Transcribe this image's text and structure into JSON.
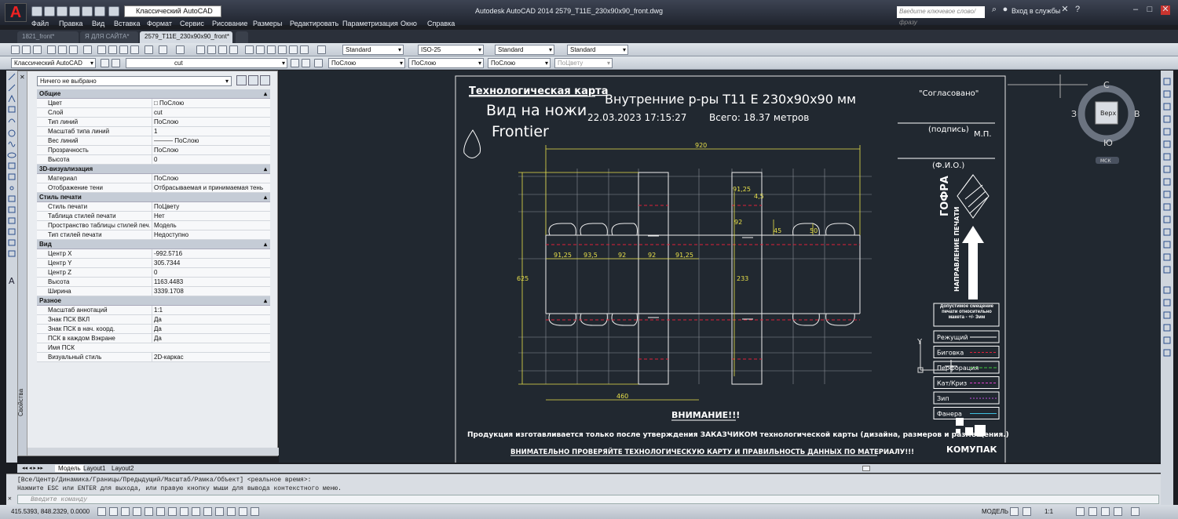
{
  "app": {
    "title": "Autodesk AutoCAD 2014    2579_T11E_230x90x90_front.dwg",
    "workspace": "Классический AutoCAD",
    "search_placeholder": "Введите ключевое слово/фразу",
    "login": "Вход в службы",
    "logo": "A"
  },
  "menu": [
    "Файл",
    "Правка",
    "Вид",
    "Вставка",
    "Формат",
    "Сервис",
    "Рисование",
    "Размеры",
    "Редактировать",
    "Параметризация",
    "Окно",
    "Справка"
  ],
  "doc_tabs": [
    "1821_front*",
    "Я ДЛЯ САЙТА*",
    "2579_T11E_230x90x90_front*"
  ],
  "toolbar": {
    "text_style": "Standard",
    "dim_style": "ISO-25",
    "table_style": "Standard",
    "mleader_style": "Standard",
    "workspace2": "Классический AutoCAD",
    "layer": "cut",
    "color": "ПоСлою",
    "linetype": "ПоСлою",
    "lineweight": "ПоСлою",
    "plotstyle": "ПоЦвету"
  },
  "properties": {
    "panel_title": "Свойства",
    "selection": "Ничего не выбрано",
    "sections": [
      {
        "title": "Общие",
        "rows": [
          [
            "Цвет",
            "□ ПоСлою"
          ],
          [
            "Слой",
            "cut"
          ],
          [
            "Тип линий",
            "ПоСлою"
          ],
          [
            "Масштаб типа линий",
            "1"
          ],
          [
            "Вес линий",
            "——— ПоСлою"
          ],
          [
            "Прозрачность",
            "ПоСлою"
          ],
          [
            "Высота",
            "0"
          ]
        ]
      },
      {
        "title": "3D-визуализация",
        "rows": [
          [
            "Материал",
            "ПоСлою"
          ],
          [
            "Отображение тени",
            "Отбрасываемая и принимаемая тень"
          ]
        ]
      },
      {
        "title": "Стиль печати",
        "rows": [
          [
            "Стиль печати",
            "ПоЦвету"
          ],
          [
            "Таблица стилей печати",
            "Нет"
          ],
          [
            "Пространство таблицы стилей печ...",
            "Модель"
          ],
          [
            "Тип стилей печати",
            "Недоступно"
          ]
        ]
      },
      {
        "title": "Вид",
        "rows": [
          [
            "Центр X",
            "-992.5716"
          ],
          [
            "Центр Y",
            "305.7344"
          ],
          [
            "Центр Z",
            "0"
          ],
          [
            "Высота",
            "1163.4483"
          ],
          [
            "Ширина",
            "3339.1708"
          ]
        ]
      },
      {
        "title": "Разное",
        "rows": [
          [
            "Масштаб аннотаций",
            "1:1"
          ],
          [
            "Знак ПСК ВКЛ",
            "Да"
          ],
          [
            "Знак ПСК в нач. коорд.",
            "Да"
          ],
          [
            "ПСК в каждом Вэкране",
            "Да"
          ],
          [
            "Имя ПСК",
            ""
          ],
          [
            "Визуальный стиль",
            "2D-каркас"
          ]
        ]
      }
    ]
  },
  "layout_tabs": [
    "Модель",
    "Layout1",
    "Layout2"
  ],
  "sheet": {
    "heading": "Технологическая карта",
    "view": "Вид на ножи",
    "machine": "Frontier",
    "product": "Внутренние р-ры T11 E 230x90x90 мм",
    "datetime": "22.03.2023 17:15:27",
    "total": "Всего: 18.37 метров",
    "approved": "\"Согласовано\"",
    "signature": "(подпись)",
    "mp": "М.П.",
    "fio": "(Ф.И.О.)",
    "material": "ГОФРА",
    "direction": "НАПРАВЛЕНИЕ ПЕЧАТИ",
    "tolerance": "Допустимое смещение печати относительно макета - +/- 3мм",
    "legend": [
      {
        "label": "Режущий",
        "color": "#ffffff",
        "dash": "0"
      },
      {
        "label": "Биговка",
        "color": "#e0203a",
        "dash": "3 2"
      },
      {
        "label": "Перфорация",
        "color": "#3ec93e",
        "dash": "4 2"
      },
      {
        "label": "Кат/Криз",
        "color": "#e040d0",
        "dash": "3 2"
      },
      {
        "label": "Зип",
        "color": "#c050e0",
        "dash": "2 2"
      },
      {
        "label": "Фанера",
        "color": "#40c0e0",
        "dash": "0"
      }
    ],
    "attention": "ВНИМАНИЕ!!!",
    "notice": "Продукция изготавливается только после утверждения ЗАКАЗЧИКОМ технологической карты (дизайна, размеров и размещения.)",
    "check": "ВНИМАТЕЛЬНО ПРОВЕРЯЙТЕ ТЕХНОЛОГИЧЕСКУЮ КАРТУ И ПРАВИЛЬНОСТЬ ДАННЫХ ПО МАТЕРИАЛУ!!!",
    "brand": "КОМУПАК",
    "dims": {
      "overall_w": "920",
      "overall_h": "625",
      "bottom_w": "460",
      "d1": "91,25",
      "d2": "93,5",
      "d3": "92",
      "d4": "92",
      "d5": "91,25",
      "v1": "91,25",
      "v2": "4,5",
      "v3": "92",
      "v4": "45",
      "v5": "50",
      "v6": "233"
    }
  },
  "viewcube": {
    "north": "С",
    "south": "Ю",
    "west": "З",
    "east": "В",
    "top": "Верх",
    "ucs": "МСК"
  },
  "ucs_label": "Y",
  "command": {
    "line1": "[Все/Центр/Динамика/Границы/Предыдущий/Масштаб/Рамка/Объект] <реальное время>:",
    "line2": "Нажмите ESC или ENTER для выхода, или правую кнопку мыши для вывода контекстного меню.",
    "placeholder": "Введите команду"
  },
  "status": {
    "coords": "415.5393,  848.2329, 0.0000",
    "model": "МОДЕЛЬ",
    "scale": "1:1"
  }
}
